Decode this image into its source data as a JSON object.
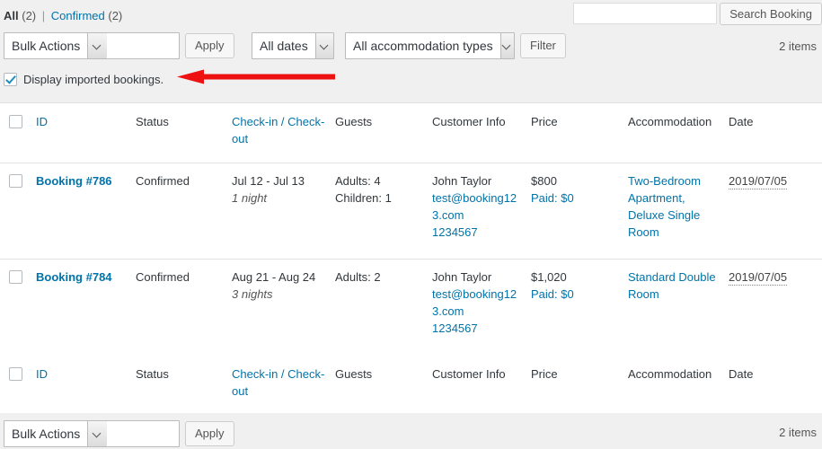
{
  "views": {
    "all_label": "All",
    "all_count": "(2)",
    "separator": "|",
    "confirmed_label": "Confirmed",
    "confirmed_count": "(2)"
  },
  "search": {
    "value": "",
    "placeholder": "",
    "button_label": "Search Booking"
  },
  "toolbar_top": {
    "bulk_actions_value": "Bulk Actions",
    "apply_label": "Apply",
    "all_dates_value": "All dates",
    "all_accommodation_value": "All accommodation types",
    "filter_label": "Filter",
    "items_count": "2 items"
  },
  "imported": {
    "checked": true,
    "label": "Display imported bookings."
  },
  "annotation": {
    "arrow_color": "#ee1111",
    "direction": "left"
  },
  "table": {
    "columns": [
      {
        "key": "cb",
        "label": "",
        "link": false
      },
      {
        "key": "id",
        "label": "ID",
        "link": true
      },
      {
        "key": "status",
        "label": "Status",
        "link": false
      },
      {
        "key": "dates",
        "label": "Check-in / Check-out",
        "link": true
      },
      {
        "key": "guests",
        "label": "Guests",
        "link": false
      },
      {
        "key": "customer",
        "label": "Customer Info",
        "link": false
      },
      {
        "key": "price",
        "label": "Price",
        "link": false
      },
      {
        "key": "accommodation",
        "label": "Accommodation",
        "link": false
      },
      {
        "key": "date",
        "label": "Date",
        "link": false
      }
    ],
    "rows": [
      {
        "checked": false,
        "id": "Booking #786",
        "status": "Confirmed",
        "dates": "Jul 12 - Jul 13",
        "nights": "1 night",
        "adults": "Adults: 4",
        "children": "Children: 1",
        "customer_name": "John Taylor",
        "customer_email": "test@booking123.com",
        "customer_phone": "1234567",
        "price_total": "$800",
        "price_paid": "Paid: $0",
        "accommodation": "Two-Bedroom Apartment, Deluxe Single Room",
        "date": "2019/07/05"
      },
      {
        "checked": false,
        "id": "Booking #784",
        "status": "Confirmed",
        "dates": "Aug 21 - Aug 24",
        "nights": "3 nights",
        "adults": "Adults: 2",
        "children": "",
        "customer_name": "John Taylor",
        "customer_email": "test@booking123.com",
        "customer_phone": "1234567",
        "price_total": "$1,020",
        "price_paid": "Paid: $0",
        "accommodation": "Standard Double Room",
        "date": "2019/07/05"
      }
    ]
  },
  "toolbar_bottom": {
    "bulk_actions_value": "Bulk Actions",
    "apply_label": "Apply",
    "items_count": "2 items"
  },
  "colors": {
    "link": "#0073aa",
    "text": "#32373c",
    "bg": "#f0f0f0",
    "accent_red": "#ee1111"
  }
}
